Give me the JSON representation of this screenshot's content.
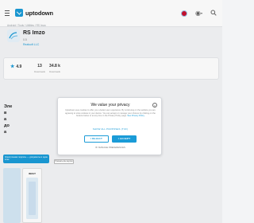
{
  "header": {
    "logo_text": "uptodown",
    "menu_icon": "hamburger-menu-icon",
    "flag_icon": "country-flag-icon",
    "lang_icon": "globe-icon",
    "lang_chevron": "▾",
    "search_icon": "search-icon",
    "brand_color": "#1a9bd7"
  },
  "breadcrumb": "Android  /  Tools  /  Utilities  /  RS Imzo",
  "app": {
    "name": "RS Imzo",
    "version": "0.5",
    "developer": "Realsoft LLC",
    "icon": "rs-imzo-app-icon"
  },
  "stats": {
    "rating": "4.9",
    "rating_label": "",
    "downloads": "13",
    "downloads_label": "Downloads",
    "size": "34.8 k",
    "size_label": "Downloads"
  },
  "background_text": {
    "line1": "Эле",
    "line2": "в",
    "line3": "а",
    "line4": "до",
    "line5": "а"
  },
  "consent": {
    "title": "We value your privacy",
    "body": "Uptodown uses cookies to offer you a better user experience. By continuing on the website you are agreeing to store cookies in your device. You can accept or manage your choices by clicking on the buttons below or at any time in the Privacy Policy page. ",
    "policy_link": "See Privacy Policy",
    "show_purposes": "SHOW ALL PURPOSES (TCF)",
    "reject_label": "I REJECT",
    "accept_label": "I ACCEPT",
    "manage_label": "MANAGE PREFERENCES",
    "manage_icon": "gear-icon",
    "close_icon": "close-icon"
  },
  "promo": {
    "banner_text": "Электронная подпись — документы в один клик",
    "older_versions": "Показать все версии"
  },
  "screenshots": {
    "title": "IMZAT"
  }
}
